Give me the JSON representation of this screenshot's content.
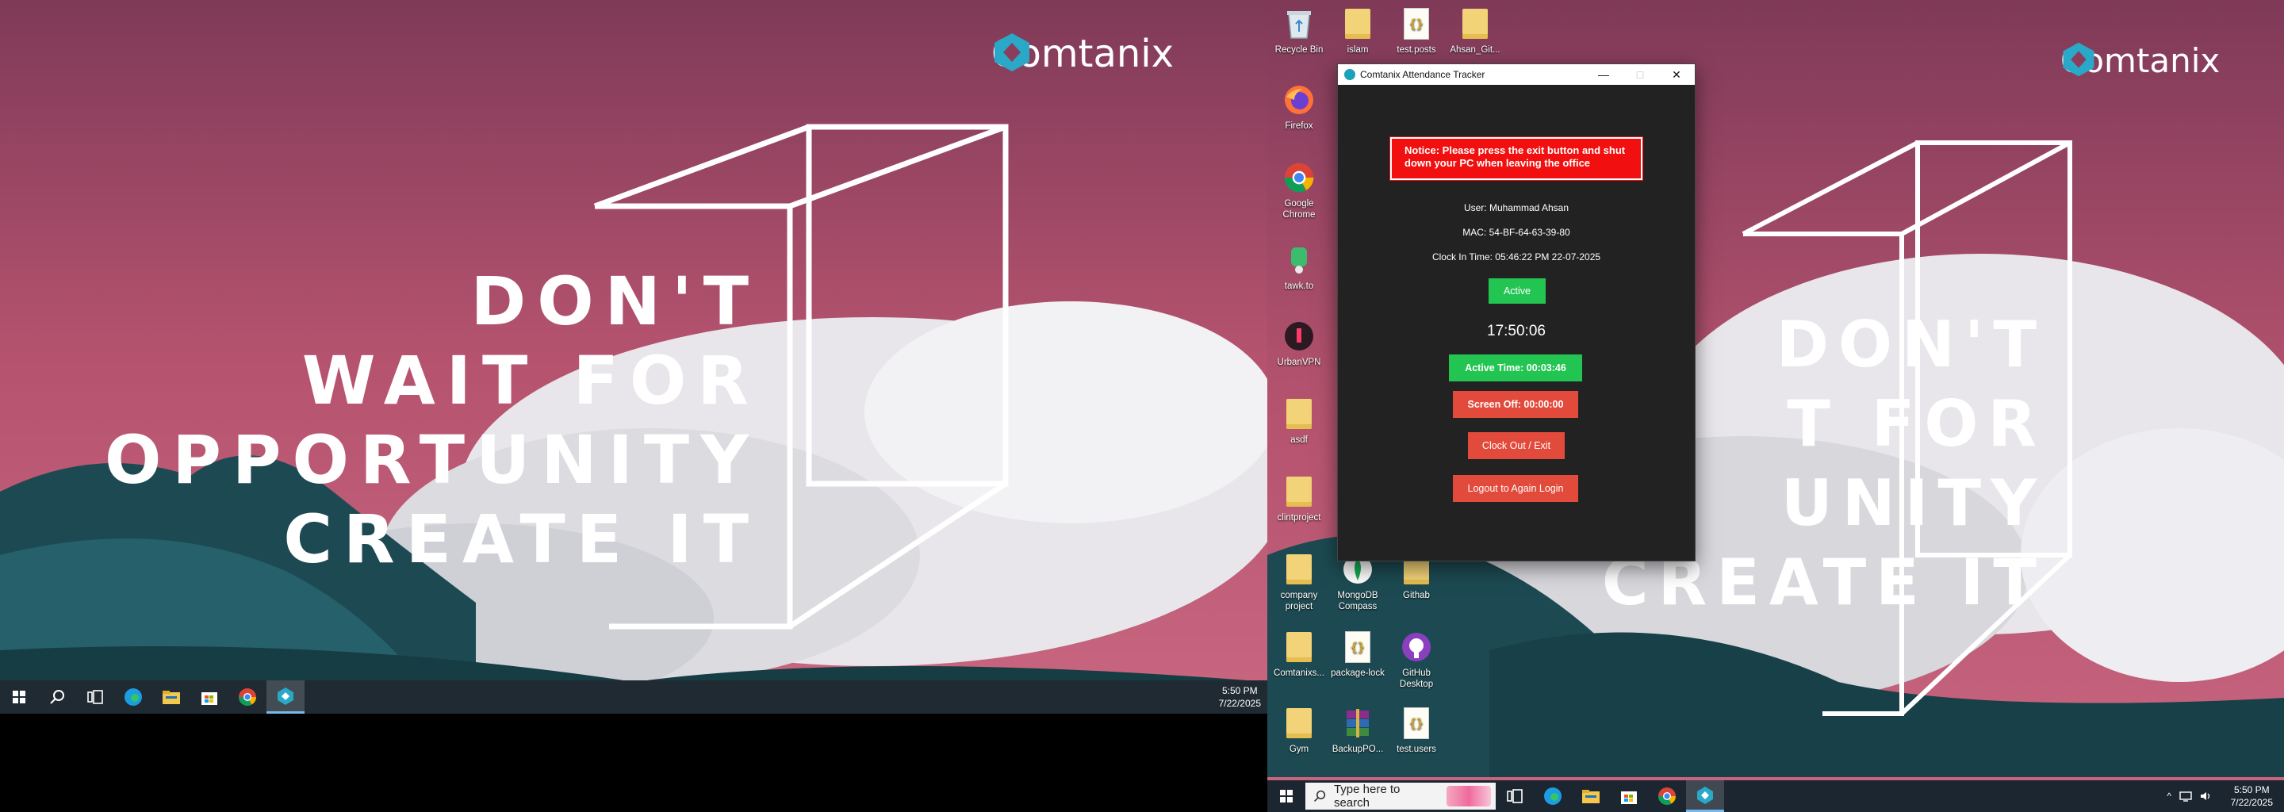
{
  "brand": {
    "name": "Comtanix"
  },
  "wallpaper": {
    "slogan": [
      "DON'T",
      "WAIT FOR",
      "OPPORTUNITY",
      "CREATE IT"
    ],
    "slogan_right": [
      "DON'T",
      "T FOR",
      "UNITY",
      "CREATE IT"
    ]
  },
  "left_taskbar": {
    "clock": {
      "time": "5:50 PM",
      "date": "7/22/2025"
    },
    "apps": [
      "start-icon",
      "search-icon",
      "task-view-icon",
      "edge-icon",
      "file-explorer-icon",
      "store-icon",
      "chrome-icon",
      "tracker-icon"
    ]
  },
  "right_taskbar": {
    "search_placeholder": "Type here to search",
    "clock": {
      "time": "5:50 PM",
      "date": "7/22/2025"
    }
  },
  "desktop_icons": [
    {
      "label": "Recycle Bin",
      "icon": "recycle-bin-icon"
    },
    {
      "label": "islam",
      "icon": "folder-icon"
    },
    {
      "label": "test.posts",
      "icon": "json-file-icon"
    },
    {
      "label": "Ahsan_Git...",
      "icon": "folder-icon"
    },
    {
      "label": "Firefox",
      "icon": "firefox-icon"
    },
    {
      "label": "Google Chrome",
      "icon": "chrome-icon"
    },
    {
      "label": "tawk.to",
      "icon": "tawk-icon"
    },
    {
      "label": "UrbanVPN",
      "icon": "vpn-icon"
    },
    {
      "label": "asdf",
      "icon": "folder-icon"
    },
    {
      "label": "clintproject",
      "icon": "folder-icon"
    },
    {
      "label": "company project",
      "icon": "folder-icon"
    },
    {
      "label": "MongoDB Compass",
      "icon": "mongodb-icon"
    },
    {
      "label": "Githab",
      "icon": "folder-icon"
    },
    {
      "label": "Comtanixs...",
      "icon": "folder-icon"
    },
    {
      "label": "package-lock",
      "icon": "json-file-icon"
    },
    {
      "label": "GitHub Desktop",
      "icon": "github-icon"
    },
    {
      "label": "Gym",
      "icon": "folder-icon"
    },
    {
      "label": "BackupPO...",
      "icon": "winrar-icon"
    },
    {
      "label": "test.users",
      "icon": "json-file-icon"
    }
  ],
  "app": {
    "title": "Comtanix Attendance Tracker",
    "notice": "Notice: Please press the exit button and shut down your PC when leaving the office",
    "user": "User: Muhammad Ahsan",
    "mac": "MAC: 54-BF-64-63-39-80",
    "clock_in": "Clock In Time: 05:46:22 PM 22-07-2025",
    "status": "Active",
    "current_time": "17:50:06",
    "active_time": "Active Time: 00:03:46",
    "screen_off": "Screen Off: 00:00:00",
    "clock_out_label": "Clock Out / Exit",
    "logout_label": "Logout to Again Login",
    "colors": {
      "active": "#23c552",
      "danger": "#e24a3b",
      "notice": "#f20f0f"
    }
  }
}
